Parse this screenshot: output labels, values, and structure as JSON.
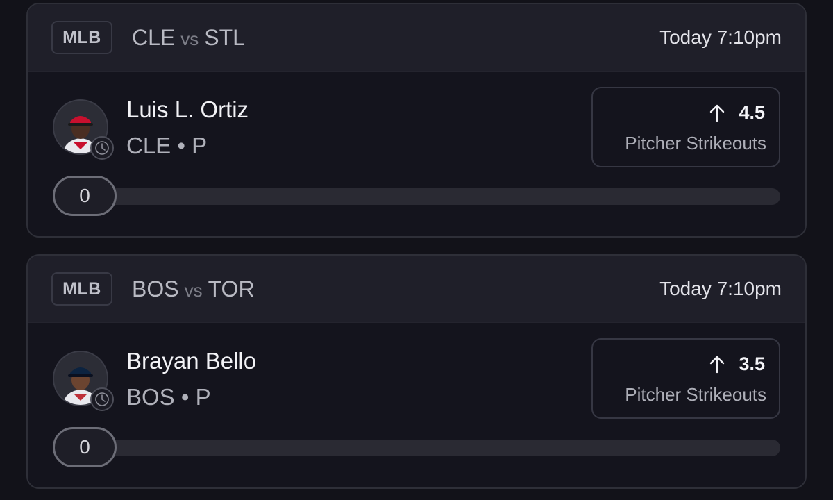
{
  "cards": [
    {
      "league": "MLB",
      "team_home": "CLE",
      "vs": "vs",
      "team_away": "STL",
      "time": "Today 7:10pm",
      "player_name": "Luis L. Ortiz",
      "player_team": "CLE",
      "separator": "•",
      "player_position": "P",
      "prop_direction": "up-arrow-icon",
      "prop_value": "4.5",
      "prop_stat": "Pitcher Strikeouts",
      "current_count": "0",
      "progress_fraction": 0,
      "cap_color": "#c8102e"
    },
    {
      "league": "MLB",
      "team_home": "BOS",
      "vs": "vs",
      "team_away": "TOR",
      "time": "Today 7:10pm",
      "player_name": "Brayan Bello",
      "player_team": "BOS",
      "separator": "•",
      "player_position": "P",
      "prop_direction": "up-arrow-icon",
      "prop_value": "3.5",
      "prop_stat": "Pitcher Strikeouts",
      "current_count": "0",
      "progress_fraction": 0,
      "cap_color": "#0c2340"
    }
  ]
}
